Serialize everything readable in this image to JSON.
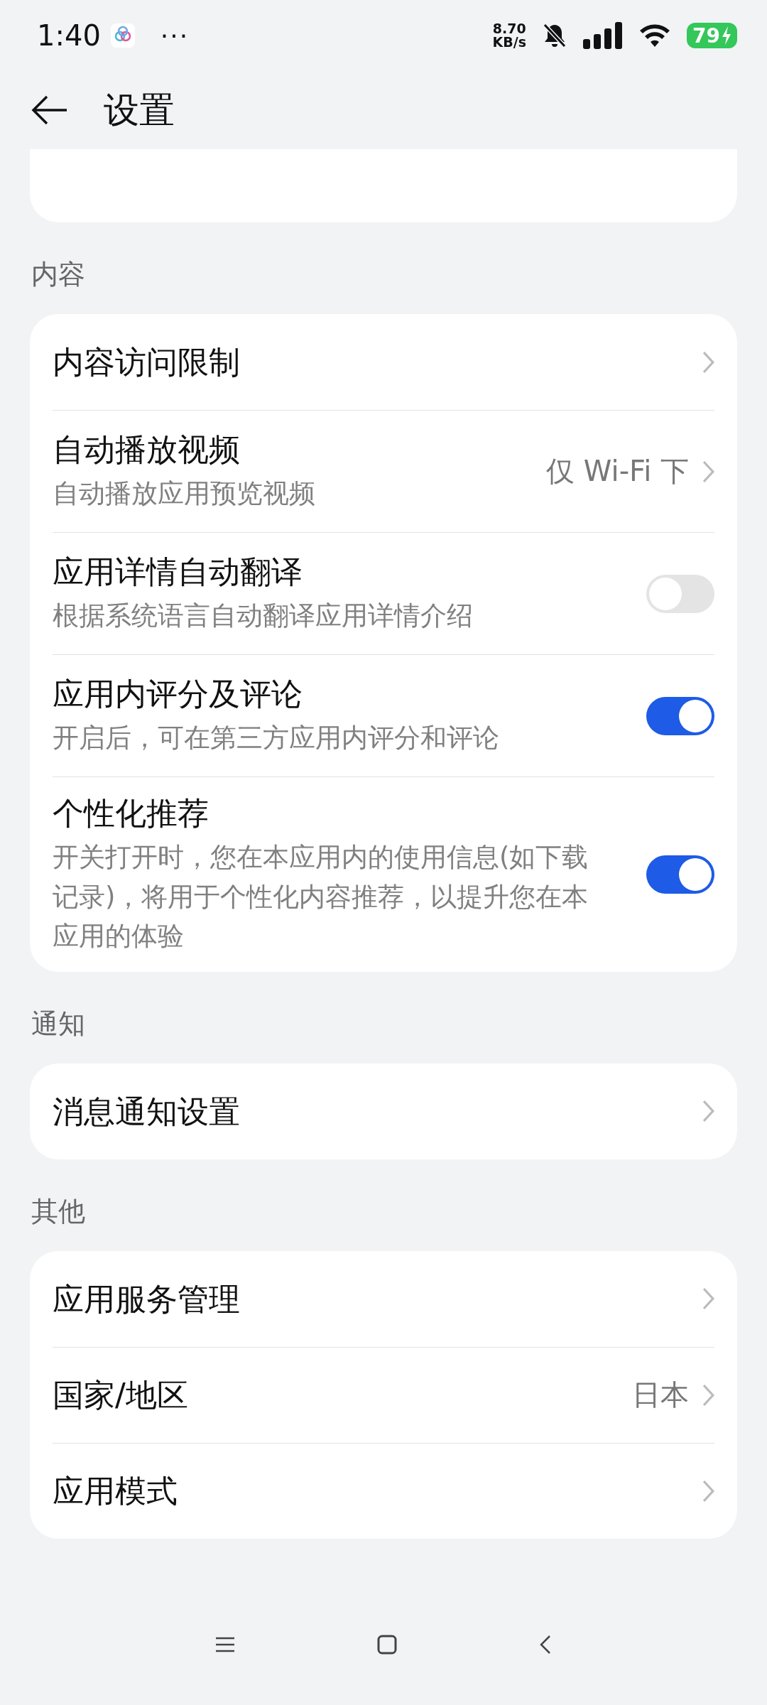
{
  "status_bar": {
    "time": "1:40",
    "more": "···",
    "speed_value": "8.70",
    "speed_unit": "KB/s",
    "battery": "79"
  },
  "header": {
    "title": "设置"
  },
  "sections": [
    {
      "label": "内容",
      "rows": [
        {
          "kind": "link",
          "title": "内容访问限制"
        },
        {
          "kind": "link",
          "title": "自动播放视频",
          "subtitle": "自动播放应用预览视频",
          "value": "仅 Wi-Fi 下"
        },
        {
          "kind": "toggle",
          "title": "应用详情自动翻译",
          "subtitle": "根据系统语言自动翻译应用详情介绍",
          "on": false
        },
        {
          "kind": "toggle",
          "title": "应用内评分及评论",
          "subtitle": "开启后，可在第三方应用内评分和评论",
          "on": true
        },
        {
          "kind": "toggle",
          "title": "个性化推荐",
          "subtitle": "开关打开时，您在本应用内的使用信息(如下载记录)，将用于个性化内容推荐，以提升您在本应用的体验",
          "on": true
        }
      ]
    },
    {
      "label": "通知",
      "rows": [
        {
          "kind": "link",
          "title": "消息通知设置"
        }
      ]
    },
    {
      "label": "其他",
      "rows": [
        {
          "kind": "link",
          "title": "应用服务管理"
        },
        {
          "kind": "link",
          "title": "国家/地区",
          "value": "日本"
        },
        {
          "kind": "link",
          "title": "应用模式"
        }
      ]
    }
  ]
}
